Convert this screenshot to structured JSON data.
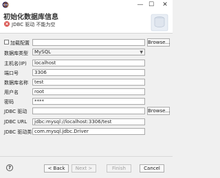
{
  "window": {
    "minimize_glyph": "—",
    "maximize_glyph": "☐",
    "close_glyph": "✕"
  },
  "header": {
    "title": "初始化数据库信息",
    "error_glyph": "×",
    "error_message": "JDBC 驱动 不能为空"
  },
  "form": {
    "load_config_label": "加载配置",
    "browse_label": "Browse...",
    "db_type_label": "数据库类型",
    "db_type_value": "MySQL",
    "host_label": "主机名(IP)",
    "host_value": "localhost",
    "port_label": "端口号",
    "port_value": "3306",
    "dbname_label": "数据库名称",
    "dbname_value": "test",
    "user_label": "用户名",
    "user_value": "root",
    "password_label": "密码",
    "password_value": "****",
    "jdbc_driver_label": "JDBC 驱动",
    "jdbc_driver_value": "",
    "jdbc_browse_label": "Browse...",
    "jdbc_url_label": "JDBC URL",
    "jdbc_url_value": "jdbc:mysql://localhost:3306/test",
    "jdbc_class_label": "JDBC 驱动类名",
    "jdbc_class_value": "com.mysql.jdbc.Driver"
  },
  "footer": {
    "help_glyph": "?",
    "back_label": "< Back",
    "next_label": "Next >",
    "finish_label": "Finish",
    "cancel_label": "Cancel"
  }
}
